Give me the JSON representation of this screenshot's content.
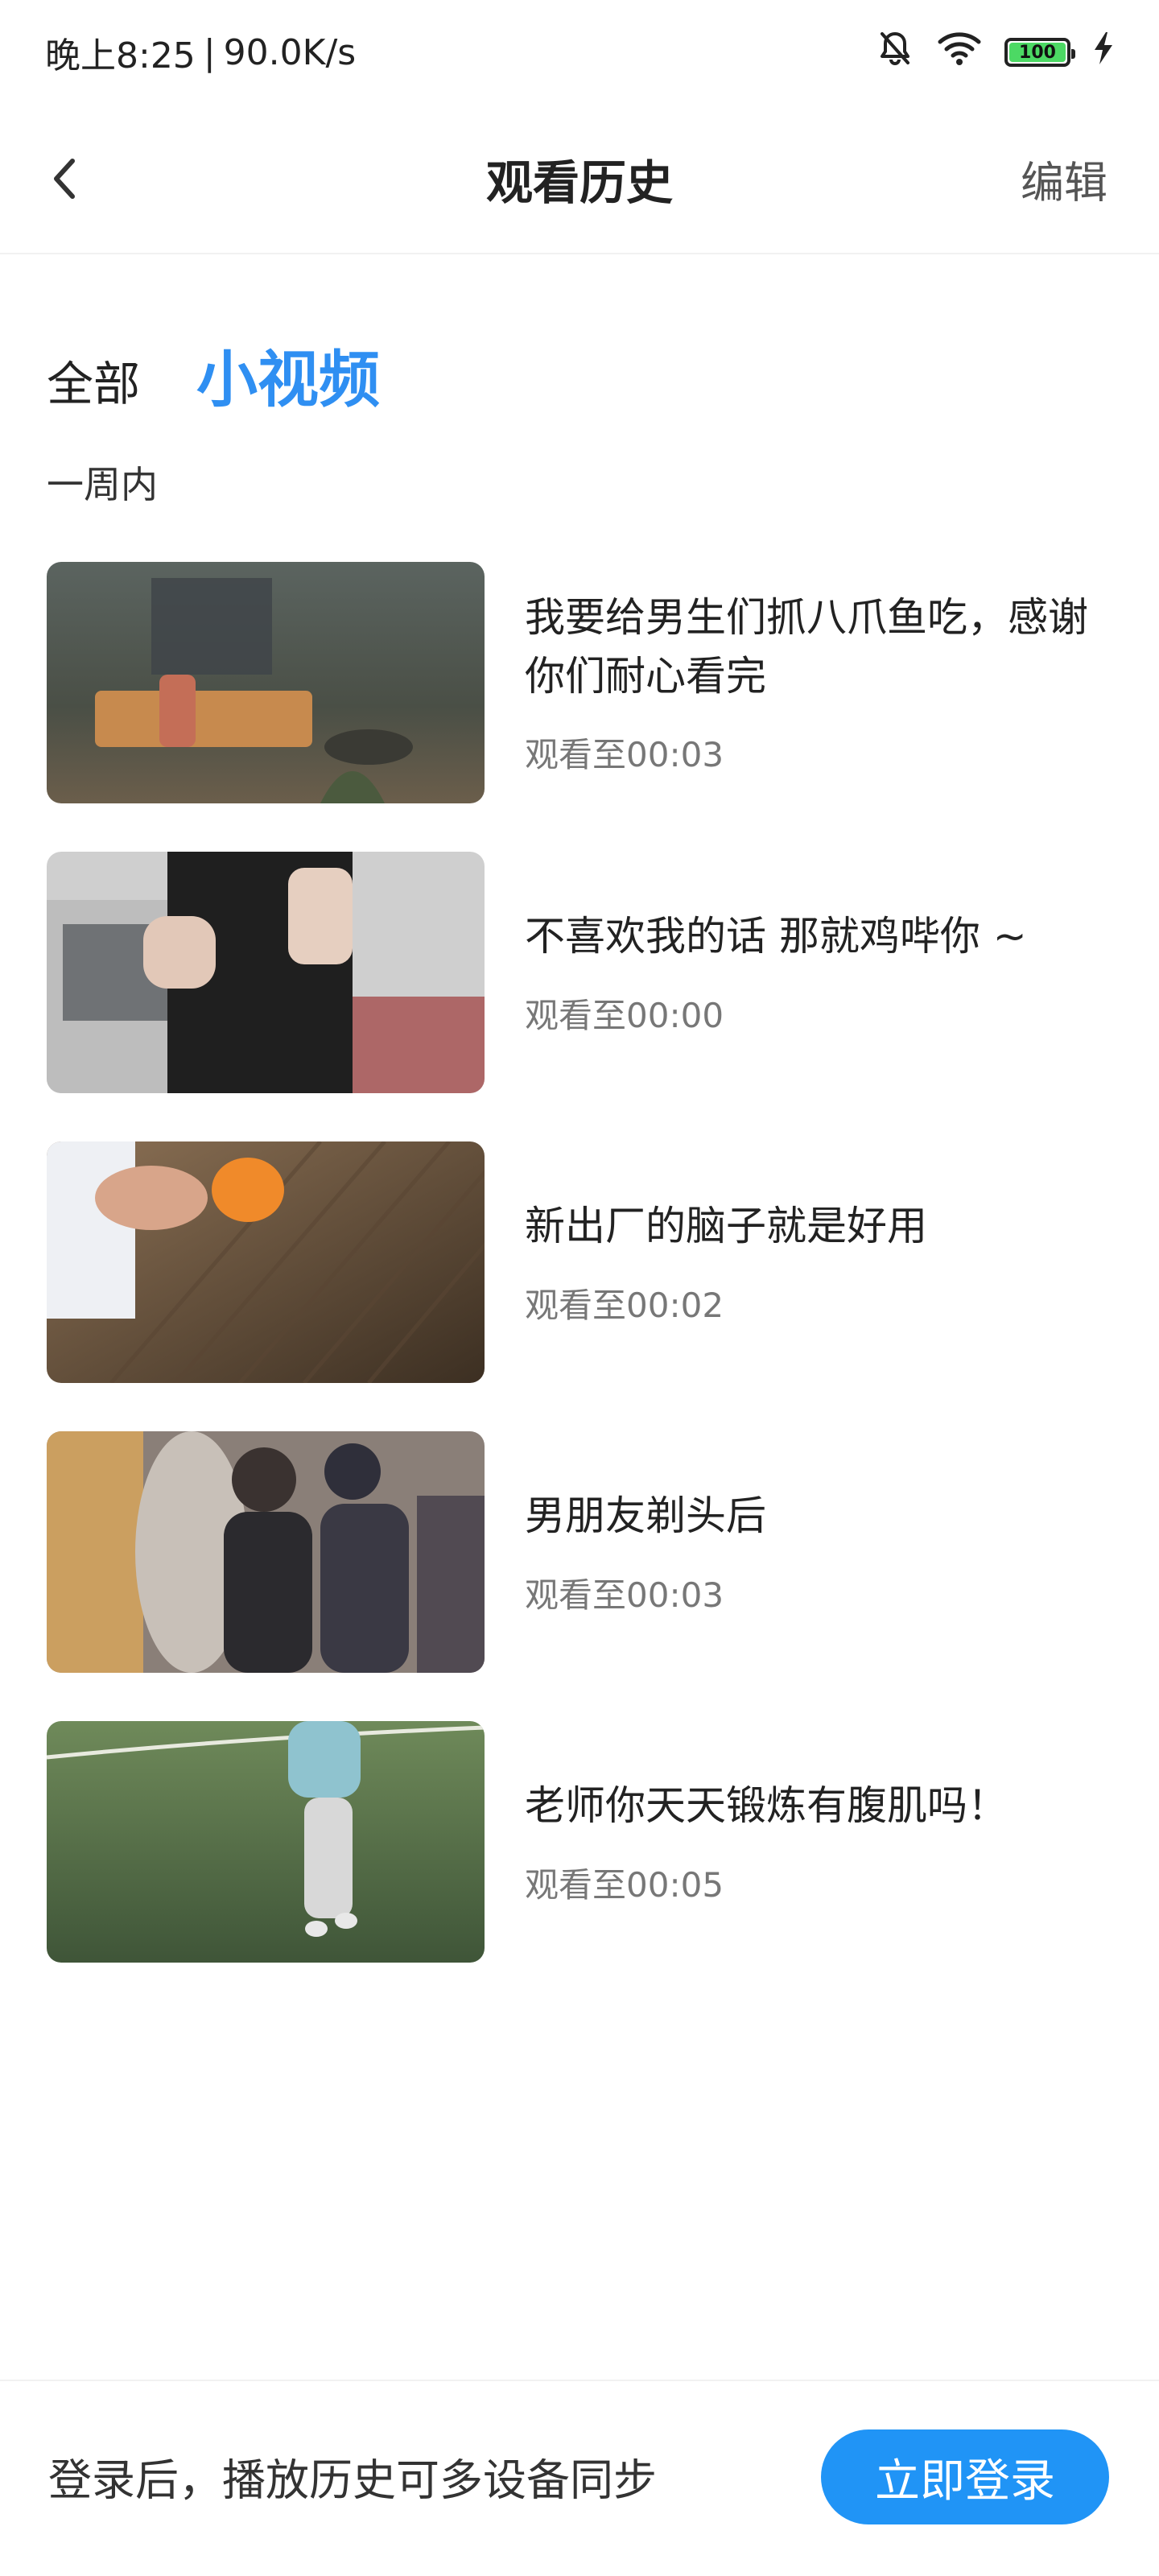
{
  "status_bar": {
    "time": "晚上8:25",
    "separator": "|",
    "speed": "90.0K/s",
    "battery": "100",
    "icons": [
      "bell-off-icon",
      "wifi-icon",
      "battery-icon",
      "charging-icon"
    ]
  },
  "header": {
    "back_icon": "chevron-left-icon",
    "title": "观看历史",
    "edit_label": "编辑"
  },
  "tabs": [
    {
      "label": "全部",
      "active": false
    },
    {
      "label": "小视频",
      "active": true
    }
  ],
  "section": {
    "label": "一周内"
  },
  "items": [
    {
      "title": "我要给男生们抓八爪鱼吃，感谢你们耐心看完",
      "progress": "观看至00:03"
    },
    {
      "title": "不喜欢我的话 那就鸡哔你 ~",
      "progress": "观看至00:00"
    },
    {
      "title": "新出厂的脑子就是好用",
      "progress": "观看至00:02"
    },
    {
      "title": "男朋友剃头后",
      "progress": "观看至00:03"
    },
    {
      "title": "老师你天天锻炼有腹肌吗！",
      "progress": "观看至00:05"
    }
  ],
  "bottom_bar": {
    "prompt": "登录后，播放历史可多设备同步",
    "login_label": "立即登录"
  },
  "colors": {
    "accent": "#2f8ff2",
    "button": "#2094f6",
    "battery": "#4cd964"
  }
}
